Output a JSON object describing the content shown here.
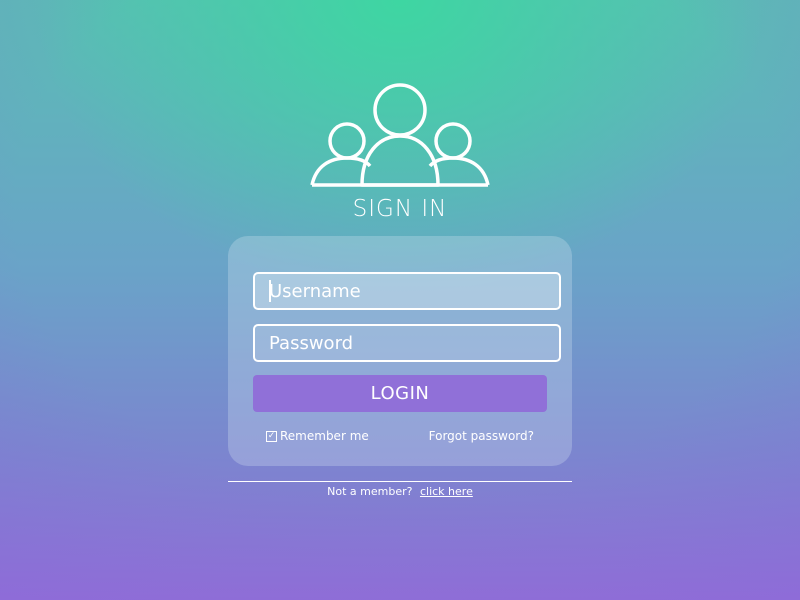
{
  "header": {
    "icon": "users-group-icon",
    "title": "SIGN IN"
  },
  "form": {
    "username_placeholder": "Username",
    "password_placeholder": "Password",
    "login_label": "LOGIN",
    "remember_label": "Remember me",
    "remember_checked": true,
    "forgot_label": "Forgot password?"
  },
  "footer": {
    "member_text": "Not a member?",
    "click_here_label": "click here"
  },
  "colors": {
    "accent": "#9070d8",
    "bg_top": "#3ed6a2",
    "bg_bottom": "#8f6fd6"
  }
}
